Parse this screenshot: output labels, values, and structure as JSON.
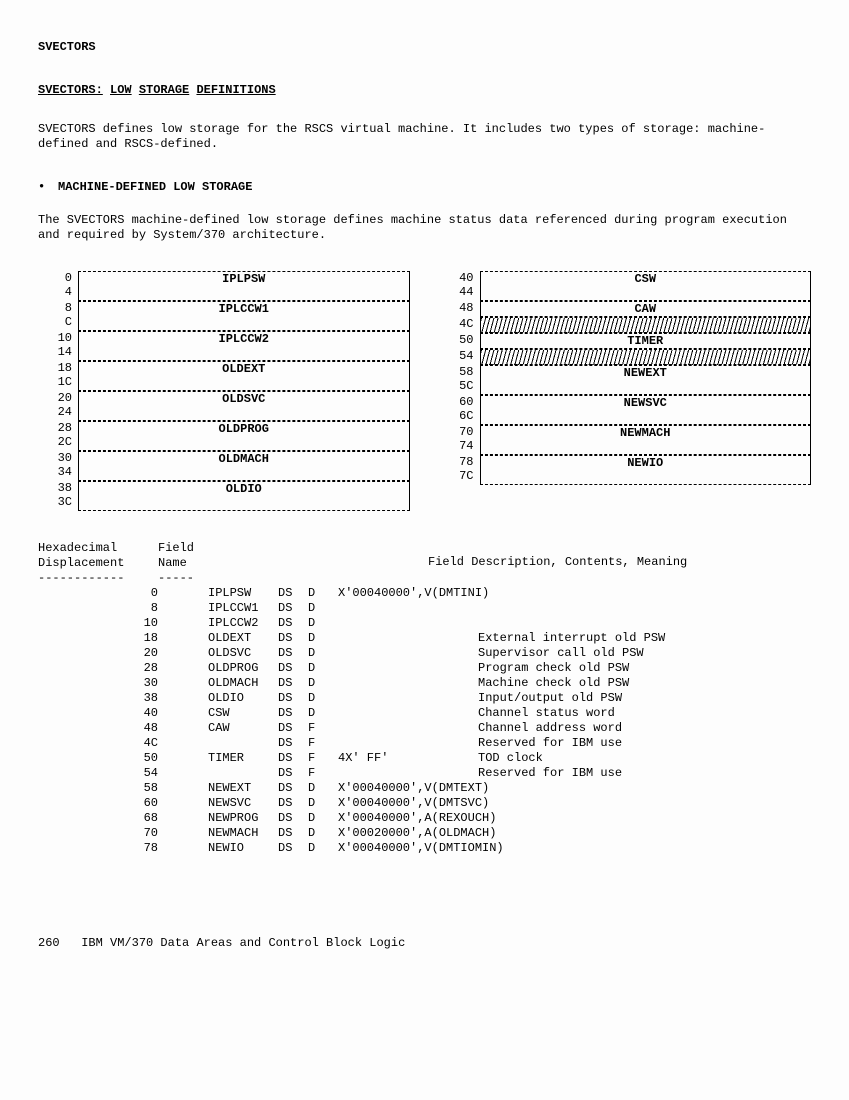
{
  "header": "SVECTORS",
  "title_prefix": "SVECTORS:",
  "title_words": [
    "LOW",
    "STORAGE",
    "DEFINITIONS"
  ],
  "intro": "SVECTORS defines  low storage  for the RSCS  virtual machine.  It  includes two  types of storage: machine-defined and RSCS-defined.",
  "section_title": "MACHINE-DEFINED LOW STORAGE",
  "section_para": "The SVECTORS  machine-defined low storage defines  machine status data  referenced during program execution and required by System/370 architecture.",
  "left_blocks": [
    {
      "off1": "0",
      "off2": "4",
      "label": "IPLPSW"
    },
    {
      "off1": "8",
      "off2": "C",
      "label": "IPLCCW1"
    },
    {
      "off1": "10",
      "off2": "14",
      "label": "IPLCCW2"
    },
    {
      "off1": "18",
      "off2": "1C",
      "label": "OLDEXT"
    },
    {
      "off1": "20",
      "off2": "24",
      "label": "OLDSVC"
    },
    {
      "off1": "28",
      "off2": "2C",
      "label": "OLDPROG"
    },
    {
      "off1": "30",
      "off2": "34",
      "label": "OLDMACH"
    },
    {
      "off1": "38",
      "off2": "3C",
      "label": "OLDIO"
    }
  ],
  "right_blocks": [
    {
      "off1": "40",
      "off2": "44",
      "label": "CSW",
      "type": "double"
    },
    {
      "off1": "48",
      "off2": "",
      "label": "CAW",
      "type": "single"
    },
    {
      "off1": "4C",
      "off2": "",
      "label": "",
      "type": "hatched"
    },
    {
      "off1": "50",
      "off2": "",
      "label": "TIMER",
      "type": "single"
    },
    {
      "off1": "54",
      "off2": "",
      "label": "",
      "type": "hatched"
    },
    {
      "off1": "58",
      "off2": "5C",
      "label": "NEWEXT",
      "type": "double"
    },
    {
      "off1": "60",
      "off2": "6C",
      "label": "NEWSVC",
      "type": "double"
    },
    {
      "off1": "70",
      "off2": "74",
      "label": "NEWMACH",
      "type": "double"
    },
    {
      "off1": "78",
      "off2": "7C",
      "label": "NEWIO",
      "type": "double"
    }
  ],
  "table_header": {
    "c1a": "Hexadecimal",
    "c1b": "Displacement",
    "c2a": "Field",
    "c2b": "Name",
    "c3": "Field Description, Contents, Meaning"
  },
  "dashes": {
    "d1": "------------",
    "d2": "-----"
  },
  "rows": [
    {
      "disp": "0",
      "name": "IPLPSW",
      "ds": "DS",
      "t": "D",
      "extra": "X'00040000',V(DMTINI)",
      "desc": ""
    },
    {
      "disp": "8",
      "name": "IPLCCW1",
      "ds": "DS",
      "t": "D",
      "extra": "",
      "desc": ""
    },
    {
      "disp": "10",
      "name": "IPLCCW2",
      "ds": "DS",
      "t": "D",
      "extra": "",
      "desc": ""
    },
    {
      "disp": "18",
      "name": "OLDEXT",
      "ds": "DS",
      "t": "D",
      "extra": "",
      "desc": "External interrupt old PSW"
    },
    {
      "disp": "20",
      "name": "OLDSVC",
      "ds": "DS",
      "t": "D",
      "extra": "",
      "desc": "Supervisor call old PSW"
    },
    {
      "disp": "28",
      "name": "OLDPROG",
      "ds": "DS",
      "t": "D",
      "extra": "",
      "desc": "Program check old PSW"
    },
    {
      "disp": "30",
      "name": "OLDMACH",
      "ds": "DS",
      "t": "D",
      "extra": "",
      "desc": "Machine check old PSW"
    },
    {
      "disp": "38",
      "name": "OLDIO",
      "ds": "DS",
      "t": "D",
      "extra": "",
      "desc": "Input/output old PSW"
    },
    {
      "disp": "40",
      "name": "CSW",
      "ds": "DS",
      "t": "D",
      "extra": "",
      "desc": "Channel status word"
    },
    {
      "disp": "48",
      "name": "CAW",
      "ds": "DS",
      "t": "F",
      "extra": "",
      "desc": "Channel address word"
    },
    {
      "disp": "4C",
      "name": "",
      "ds": "DS",
      "t": "F",
      "extra": "",
      "desc": "Reserved for IBM use"
    },
    {
      "disp": "50",
      "name": "TIMER",
      "ds": "DS",
      "t": "F",
      "extra": "4X' FF'",
      "desc": "TOD clock"
    },
    {
      "disp": "54",
      "name": "",
      "ds": "DS",
      "t": "F",
      "extra": "",
      "desc": "Reserved for IBM use"
    },
    {
      "disp": "58",
      "name": "NEWEXT",
      "ds": "DS",
      "t": "D",
      "extra": "X'00040000',V(DMTEXT)",
      "desc": ""
    },
    {
      "disp": "60",
      "name": "NEWSVC",
      "ds": "DS",
      "t": "D",
      "extra": "X'00040000',V(DMTSVC)",
      "desc": ""
    },
    {
      "disp": "68",
      "name": "NEWPROG",
      "ds": "DS",
      "t": "D",
      "extra": "X'00040000',A(REXOUCH)",
      "desc": ""
    },
    {
      "disp": "70",
      "name": "NEWMACH",
      "ds": "DS",
      "t": "D",
      "extra": "X'00020000',A(OLDMACH)",
      "desc": ""
    },
    {
      "disp": "78",
      "name": "NEWIO",
      "ds": "DS",
      "t": "D",
      "extra": "X'00040000',V(DMTIOMIN)",
      "desc": ""
    }
  ],
  "footer_page": "260",
  "footer_text": "IBM VM/370 Data Areas and Control Block Logic"
}
